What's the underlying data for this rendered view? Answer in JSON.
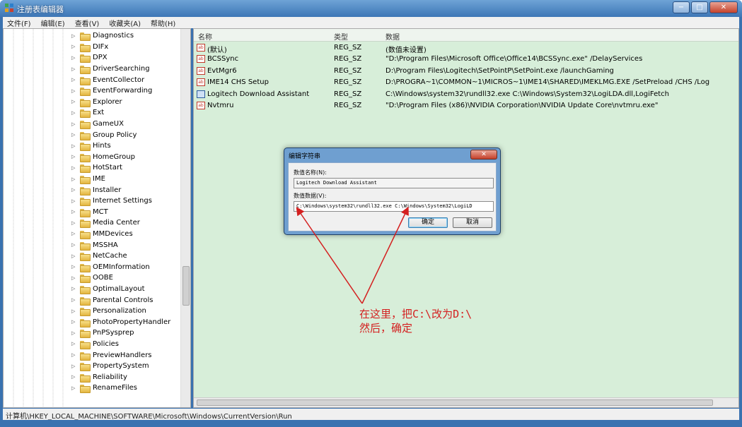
{
  "window": {
    "title": "注册表编辑器",
    "buttons": {
      "minimize": "−",
      "maximize": "□",
      "close": "✕"
    }
  },
  "menu": [
    "文件(F)",
    "编辑(E)",
    "查看(V)",
    "收藏夹(A)",
    "帮助(H)"
  ],
  "tree": {
    "items": [
      "Diagnostics",
      "DIFx",
      "DPX",
      "DriverSearching",
      "EventCollector",
      "EventForwarding",
      "Explorer",
      "Ext",
      "GameUX",
      "Group Policy",
      "Hints",
      "HomeGroup",
      "HotStart",
      "IME",
      "Installer",
      "Internet Settings",
      "MCT",
      "Media Center",
      "MMDevices",
      "MSSHA",
      "NetCache",
      "OEMInformation",
      "OOBE",
      "OptimalLayout",
      "Parental Controls",
      "Personalization",
      "PhotoPropertyHandler",
      "PnPSysprep",
      "Policies",
      "PreviewHandlers",
      "PropertySystem",
      "Reliability",
      "RenameFiles"
    ]
  },
  "values": {
    "columns": {
      "name": "名称",
      "type": "类型",
      "data": "数据"
    },
    "rows": [
      {
        "name": "(默认)",
        "type": "REG_SZ",
        "data": "(数值未设置)",
        "icon": "ab-icon"
      },
      {
        "name": "BCSSync",
        "type": "REG_SZ",
        "data": "\"D:\\Program Files\\Microsoft Office\\Office14\\BCSSync.exe\" /DelayServices",
        "icon": "ab-icon"
      },
      {
        "name": "EvtMgr6",
        "type": "REG_SZ",
        "data": "D:\\Program Files\\Logitech\\SetPointP\\SetPoint.exe /launchGaming",
        "icon": "ab-icon"
      },
      {
        "name": "IME14 CHS Setup",
        "type": "REG_SZ",
        "data": "D:\\PROGRA~1\\COMMON~1\\MICROS~1\\IME14\\SHARED\\IMEKLMG.EXE /SetPreload /CHS /Log",
        "icon": "ab-icon"
      },
      {
        "name": "Logitech Download Assistant",
        "type": "REG_SZ",
        "data": "C:\\Windows\\system32\\rundll32.exe C:\\Windows\\System32\\LogiLDA.dll,LogiFetch",
        "icon": "binary-icon"
      },
      {
        "name": "Nvtmru",
        "type": "REG_SZ",
        "data": "\"D:\\Program Files (x86)\\NVIDIA Corporation\\NVIDIA Update Core\\nvtmru.exe\"",
        "icon": "ab-icon"
      }
    ]
  },
  "statusbar": {
    "path": "计算机\\HKEY_LOCAL_MACHINE\\SOFTWARE\\Microsoft\\Windows\\CurrentVersion\\Run"
  },
  "dialog": {
    "title": "编辑字符串",
    "close": "✕",
    "name_label": "数值名称(N):",
    "name_value": "Logitech Download Assistant",
    "data_label": "数值数据(V):",
    "data_value": "C:\\Windows\\system32\\rundll32.exe C:\\Windows\\System32\\LogiLD",
    "ok": "确定",
    "cancel": "取消"
  },
  "annotation": {
    "line1": "在这里，把C:\\改为D:\\",
    "line2": "然后，确定",
    "color": "#d42020"
  }
}
